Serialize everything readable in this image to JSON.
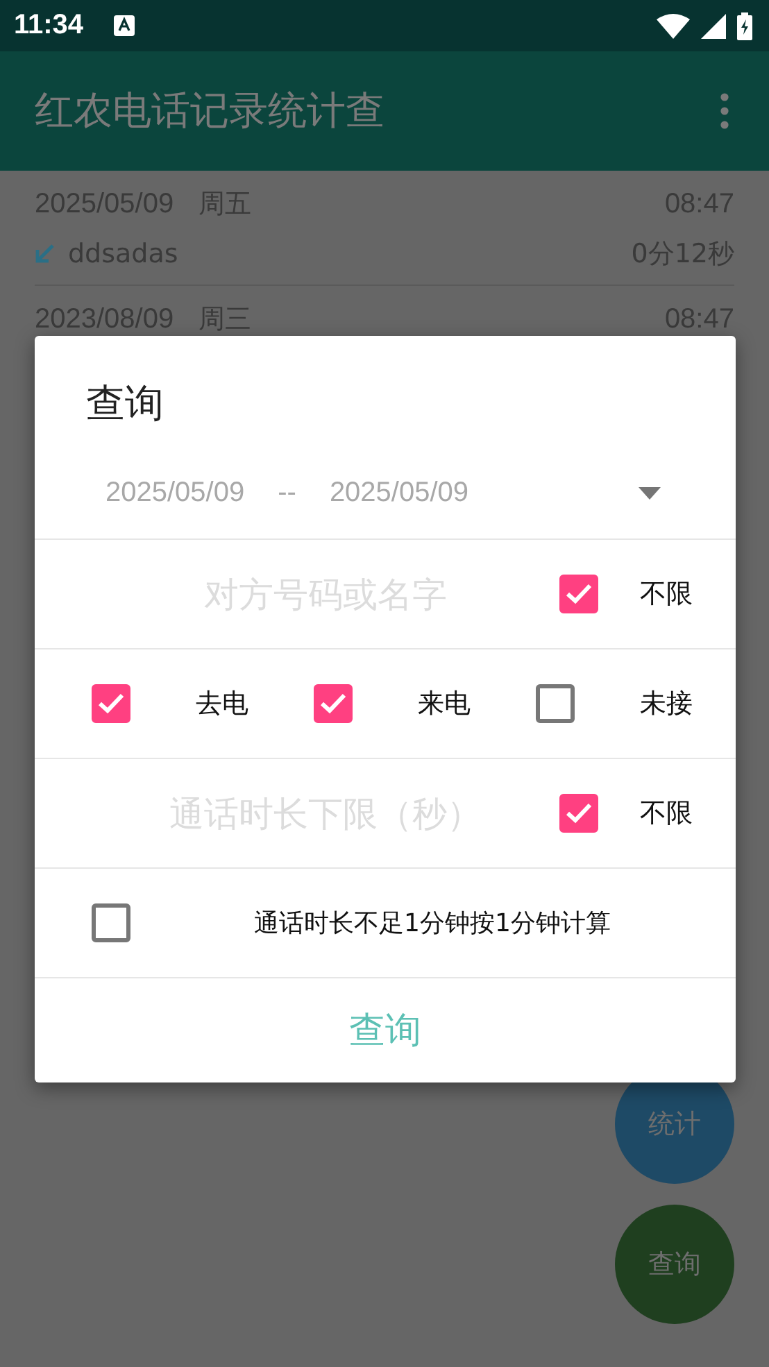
{
  "status_bar": {
    "time": "11:34"
  },
  "app_bar": {
    "title": "红农电话记录统计查"
  },
  "call_list": [
    {
      "date": "2025/05/09",
      "weekday": "周五",
      "time": "08:47",
      "kind": "incoming",
      "name": "ddsadas",
      "duration": "0分12秒"
    },
    {
      "date": "2023/08/09",
      "weekday": "周三",
      "time": "08:47"
    }
  ],
  "fabs": [
    {
      "label": "统计",
      "color": "#1e4a66"
    },
    {
      "label": "查询",
      "color": "#1f3f1f"
    }
  ],
  "dialog": {
    "title": "查询",
    "date_range": {
      "start": "2025/05/09",
      "separator": "--",
      "end": "2025/05/09"
    },
    "contact_field": {
      "placeholder": "对方号码或名字"
    },
    "contact_unlimited": {
      "label": "不限",
      "checked": true
    },
    "call_types": [
      {
        "label": "去电",
        "checked": true
      },
      {
        "label": "来电",
        "checked": true
      },
      {
        "label": "未接",
        "checked": false
      }
    ],
    "duration_field": {
      "placeholder": "通话时长下限（秒）"
    },
    "duration_unlimited": {
      "label": "不限",
      "checked": true
    },
    "round_up": {
      "label": "通话时长不足1分钟按1分钟计算",
      "checked": false
    },
    "submit_button": "查询"
  }
}
